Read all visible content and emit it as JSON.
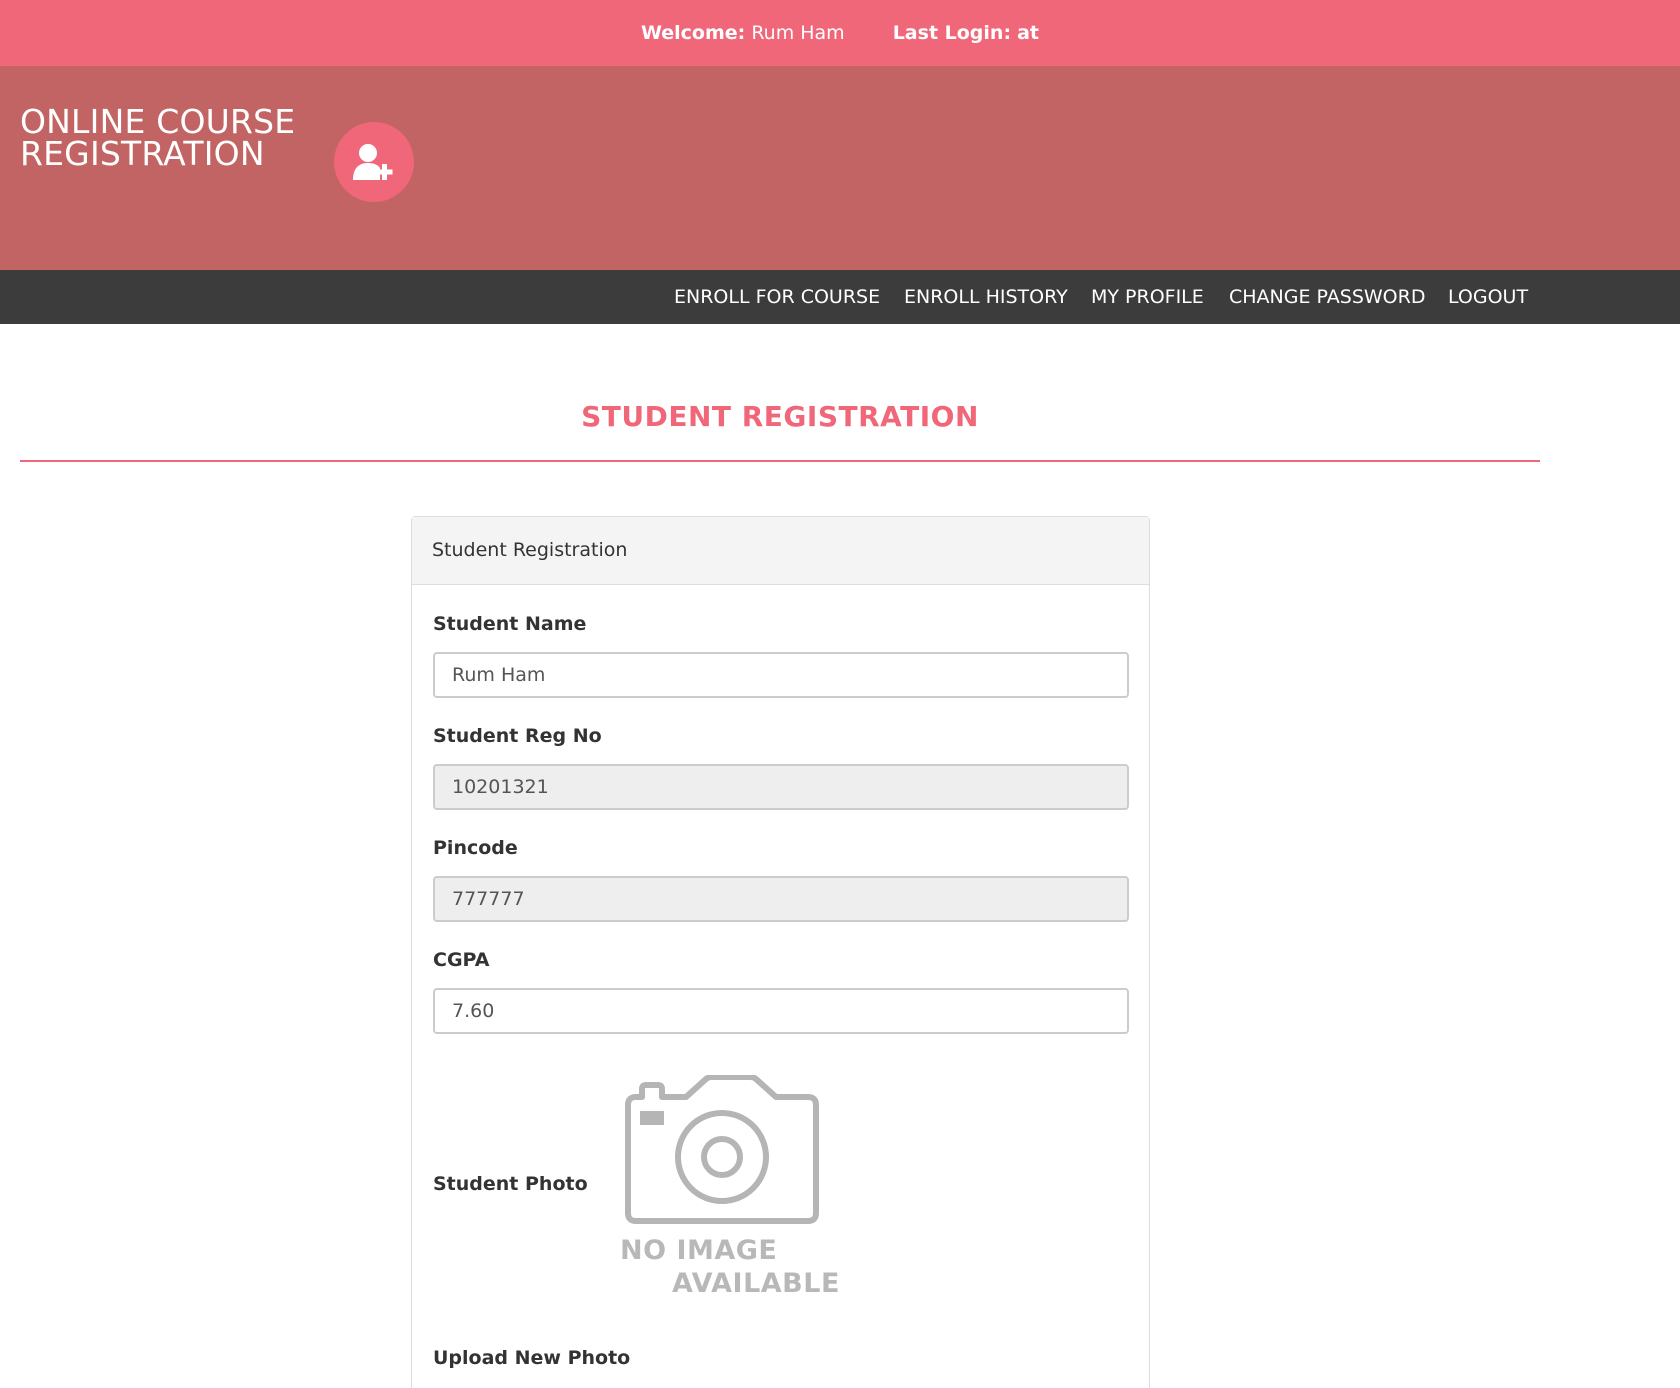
{
  "topbar": {
    "welcome_label": "Welcome:",
    "user_name": "Rum Ham",
    "last_login_label": "Last Login:",
    "last_login_value": "at"
  },
  "brand": {
    "line1": "ONLINE COURSE",
    "line2": "REGISTRATION",
    "icon": "user-plus-icon"
  },
  "nav": {
    "items": [
      {
        "label": "ENROLL FOR COURSE"
      },
      {
        "label": "ENROLL HISTORY"
      },
      {
        "label": "MY PROFILE"
      },
      {
        "label": "CHANGE PASSWORD"
      },
      {
        "label": "LOGOUT"
      }
    ]
  },
  "page": {
    "title": "STUDENT REGISTRATION"
  },
  "form": {
    "heading": "Student Registration",
    "student_name": {
      "label": "Student Name",
      "value": "Rum Ham"
    },
    "reg_no": {
      "label": "Student Reg No",
      "value": "10201321"
    },
    "pincode": {
      "label": "Pincode",
      "value": "777777"
    },
    "cgpa": {
      "label": "CGPA",
      "value": "7.60"
    },
    "photo": {
      "label": "Student Photo",
      "placeholder_line1": "NO IMAGE",
      "placeholder_line2": "AVAILABLE",
      "icon": "camera-icon"
    },
    "upload": {
      "label": "Upload New Photo"
    }
  },
  "colors": {
    "accent": "#f0677a",
    "header_bg": "#c16463",
    "nav_bg": "#3c3c3c"
  }
}
